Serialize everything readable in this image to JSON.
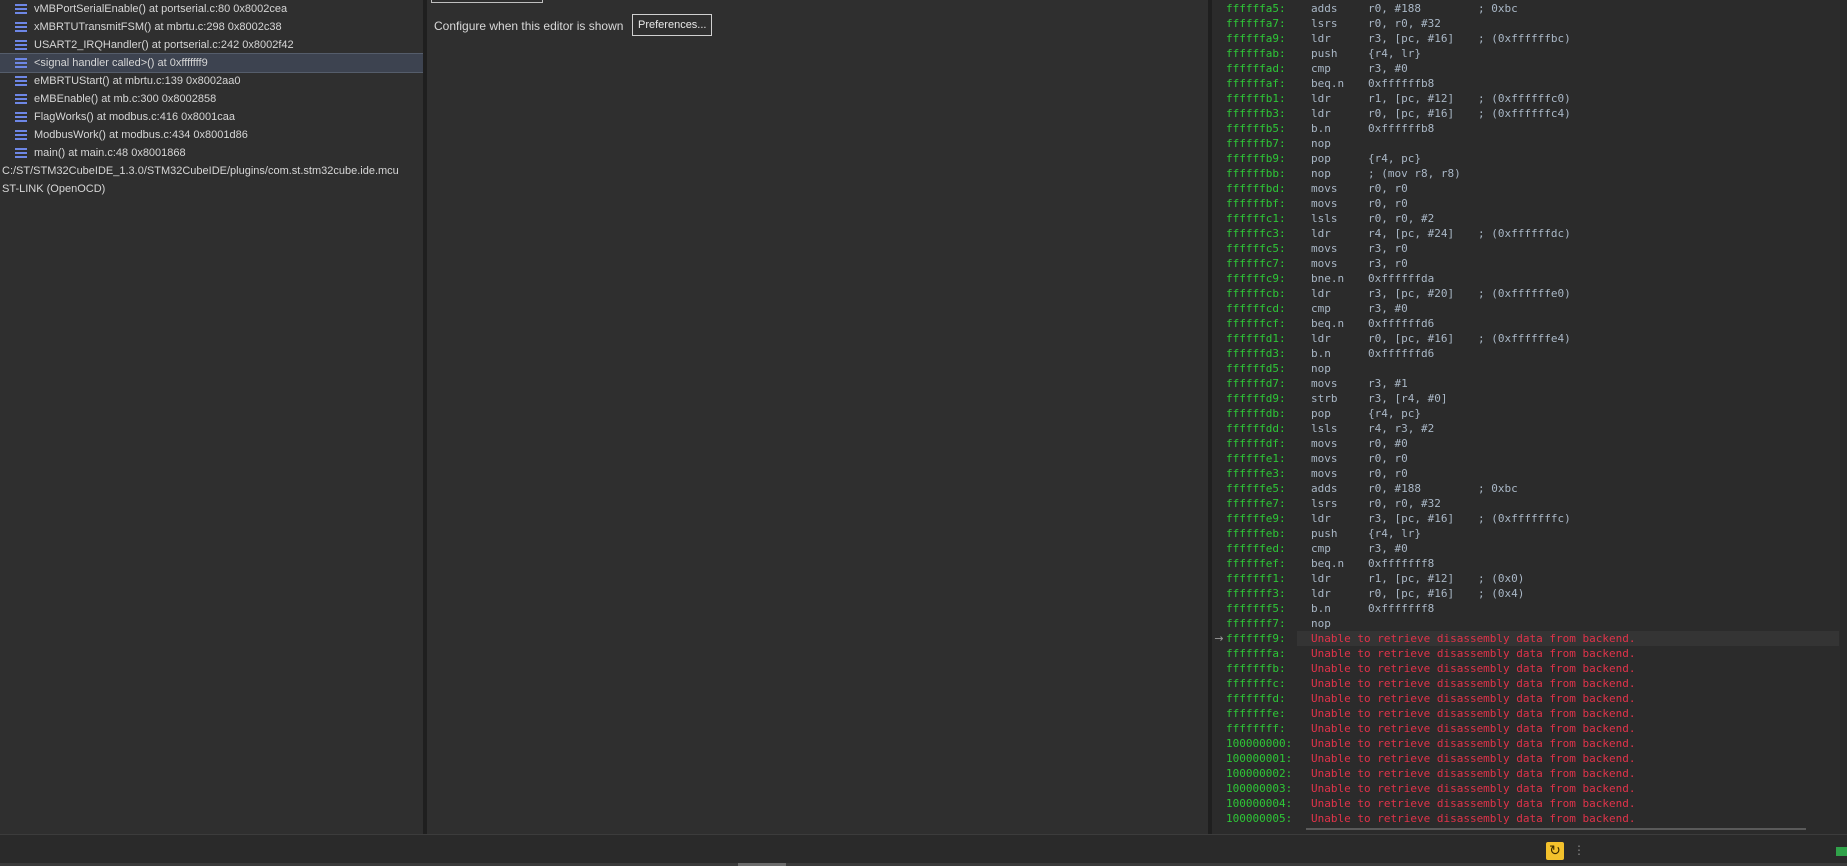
{
  "debug": {
    "frames": [
      {
        "label": "vMBPortSerialEnable() at portserial.c:80 0x8002cea"
      },
      {
        "label": "xMBRTUTransmitFSM() at mbrtu.c:298 0x8002c38"
      },
      {
        "label": "USART2_IRQHandler() at portserial.c:242 0x8002f42"
      },
      {
        "label": "<signal handler called>() at 0xfffffff9"
      },
      {
        "label": "eMBRTUStart() at mbrtu.c:139 0x8002aa0"
      },
      {
        "label": "eMBEnable() at mb.c:300 0x8002858"
      },
      {
        "label": "FlagWorks() at modbus.c:416 0x8001caa"
      },
      {
        "label": "ModbusWork() at modbus.c:434 0x8001d86"
      },
      {
        "label": "main() at main.c:48 0x8001868"
      }
    ],
    "selected_index": 3,
    "path": "C:/ST/STM32CubeIDE_1.3.0/STM32CubeIDE/plugins/com.st.stm32cube.ide.mcu",
    "probe": "ST-LINK (OpenOCD)"
  },
  "editor": {
    "configure_label": "Configure when this editor is shown",
    "preferences_button": "Preferences..."
  },
  "disassembly": {
    "pc_arrow_icon": "arrow-right-icon",
    "rows": [
      {
        "addr": "ffffffa5:",
        "mnem": "adds",
        "ops": "r0, #188",
        "cmt": "; 0xbc"
      },
      {
        "addr": "ffffffa7:",
        "mnem": "lsrs",
        "ops": "r0, r0, #32",
        "cmt": ""
      },
      {
        "addr": "ffffffa9:",
        "mnem": "ldr",
        "ops": "r3, [pc, #16]",
        "cmt": "; (0xffffffbc)"
      },
      {
        "addr": "ffffffab:",
        "mnem": "push",
        "ops": "{r4, lr}",
        "cmt": ""
      },
      {
        "addr": "ffffffad:",
        "mnem": "cmp",
        "ops": "r3, #0",
        "cmt": ""
      },
      {
        "addr": "ffffffaf:",
        "mnem": "beq.n",
        "ops": "0xffffffb8",
        "cmt": ""
      },
      {
        "addr": "ffffffb1:",
        "mnem": "ldr",
        "ops": "r1, [pc, #12]",
        "cmt": "; (0xffffffc0)"
      },
      {
        "addr": "ffffffb3:",
        "mnem": "ldr",
        "ops": "r0, [pc, #16]",
        "cmt": "; (0xffffffc4)"
      },
      {
        "addr": "ffffffb5:",
        "mnem": "b.n",
        "ops": "0xffffffb8",
        "cmt": ""
      },
      {
        "addr": "ffffffb7:",
        "mnem": "nop",
        "ops": "",
        "cmt": ""
      },
      {
        "addr": "ffffffb9:",
        "mnem": "pop",
        "ops": "{r4, pc}",
        "cmt": ""
      },
      {
        "addr": "ffffffbb:",
        "mnem": "nop",
        "ops": "; (mov r8, r8)",
        "cmt": ""
      },
      {
        "addr": "ffffffbd:",
        "mnem": "movs",
        "ops": "r0, r0",
        "cmt": ""
      },
      {
        "addr": "ffffffbf:",
        "mnem": "movs",
        "ops": "r0, r0",
        "cmt": ""
      },
      {
        "addr": "ffffffc1:",
        "mnem": "lsls",
        "ops": "r0, r0, #2",
        "cmt": ""
      },
      {
        "addr": "ffffffc3:",
        "mnem": "ldr",
        "ops": "r4, [pc, #24]",
        "cmt": "; (0xffffffdc)"
      },
      {
        "addr": "ffffffc5:",
        "mnem": "movs",
        "ops": "r3, r0",
        "cmt": ""
      },
      {
        "addr": "ffffffc7:",
        "mnem": "movs",
        "ops": "r3, r0",
        "cmt": ""
      },
      {
        "addr": "ffffffc9:",
        "mnem": "bne.n",
        "ops": "0xffffffda",
        "cmt": ""
      },
      {
        "addr": "ffffffcb:",
        "mnem": "ldr",
        "ops": "r3, [pc, #20]",
        "cmt": "; (0xffffffe0)"
      },
      {
        "addr": "ffffffcd:",
        "mnem": "cmp",
        "ops": "r3, #0",
        "cmt": ""
      },
      {
        "addr": "ffffffcf:",
        "mnem": "beq.n",
        "ops": "0xffffffd6",
        "cmt": ""
      },
      {
        "addr": "ffffffd1:",
        "mnem": "ldr",
        "ops": "r0, [pc, #16]",
        "cmt": "; (0xffffffe4)"
      },
      {
        "addr": "ffffffd3:",
        "mnem": "b.n",
        "ops": "0xffffffd6",
        "cmt": ""
      },
      {
        "addr": "ffffffd5:",
        "mnem": "nop",
        "ops": "",
        "cmt": ""
      },
      {
        "addr": "ffffffd7:",
        "mnem": "movs",
        "ops": "r3, #1",
        "cmt": ""
      },
      {
        "addr": "ffffffd9:",
        "mnem": "strb",
        "ops": "r3, [r4, #0]",
        "cmt": ""
      },
      {
        "addr": "ffffffdb:",
        "mnem": "pop",
        "ops": "{r4, pc}",
        "cmt": ""
      },
      {
        "addr": "ffffffdd:",
        "mnem": "lsls",
        "ops": "r4, r3, #2",
        "cmt": ""
      },
      {
        "addr": "ffffffdf:",
        "mnem": "movs",
        "ops": "r0, #0",
        "cmt": ""
      },
      {
        "addr": "ffffffe1:",
        "mnem": "movs",
        "ops": "r0, r0",
        "cmt": ""
      },
      {
        "addr": "ffffffe3:",
        "mnem": "movs",
        "ops": "r0, r0",
        "cmt": ""
      },
      {
        "addr": "ffffffe5:",
        "mnem": "adds",
        "ops": "r0, #188",
        "cmt": "; 0xbc"
      },
      {
        "addr": "ffffffe7:",
        "mnem": "lsrs",
        "ops": "r0, r0, #32",
        "cmt": ""
      },
      {
        "addr": "ffffffe9:",
        "mnem": "ldr",
        "ops": "r3, [pc, #16]",
        "cmt": "; (0xfffffffc)"
      },
      {
        "addr": "ffffffeb:",
        "mnem": "push",
        "ops": "{r4, lr}",
        "cmt": ""
      },
      {
        "addr": "ffffffed:",
        "mnem": "cmp",
        "ops": "r3, #0",
        "cmt": ""
      },
      {
        "addr": "ffffffef:",
        "mnem": "beq.n",
        "ops": "0xfffffff8",
        "cmt": ""
      },
      {
        "addr": "fffffff1:",
        "mnem": "ldr",
        "ops": "r1, [pc, #12]",
        "cmt": "; (0x0)"
      },
      {
        "addr": "fffffff3:",
        "mnem": "ldr",
        "ops": "r0, [pc, #16]",
        "cmt": "; (0x4)"
      },
      {
        "addr": "fffffff5:",
        "mnem": "b.n",
        "ops": "0xfffffff8",
        "cmt": ""
      },
      {
        "addr": "fffffff7:",
        "mnem": "nop",
        "ops": "",
        "cmt": ""
      },
      {
        "addr": "fffffff9:",
        "error": "Unable to retrieve disassembly data from backend.",
        "current": true
      },
      {
        "addr": "fffffffa:",
        "error": "Unable to retrieve disassembly data from backend."
      },
      {
        "addr": "fffffffb:",
        "error": "Unable to retrieve disassembly data from backend."
      },
      {
        "addr": "fffffffc:",
        "error": "Unable to retrieve disassembly data from backend."
      },
      {
        "addr": "fffffffd:",
        "error": "Unable to retrieve disassembly data from backend."
      },
      {
        "addr": "fffffffe:",
        "error": "Unable to retrieve disassembly data from backend."
      },
      {
        "addr": "ffffffff:",
        "error": "Unable to retrieve disassembly data from backend."
      },
      {
        "addr": "100000000:",
        "error": "Unable to retrieve disassembly data from backend."
      },
      {
        "addr": "100000001:",
        "error": "Unable to retrieve disassembly data from backend."
      },
      {
        "addr": "100000002:",
        "error": "Unable to retrieve disassembly data from backend."
      },
      {
        "addr": "100000003:",
        "error": "Unable to retrieve disassembly data from backend."
      },
      {
        "addr": "100000004:",
        "error": "Unable to retrieve disassembly data from backend."
      },
      {
        "addr": "100000005:",
        "error": "Unable to retrieve disassembly data from backend."
      }
    ]
  },
  "status_bar": {
    "sync_icon": "sync-icon",
    "grip_icon": "vertical-grip-icon",
    "corner_icon": "status-indicator-icon"
  }
}
